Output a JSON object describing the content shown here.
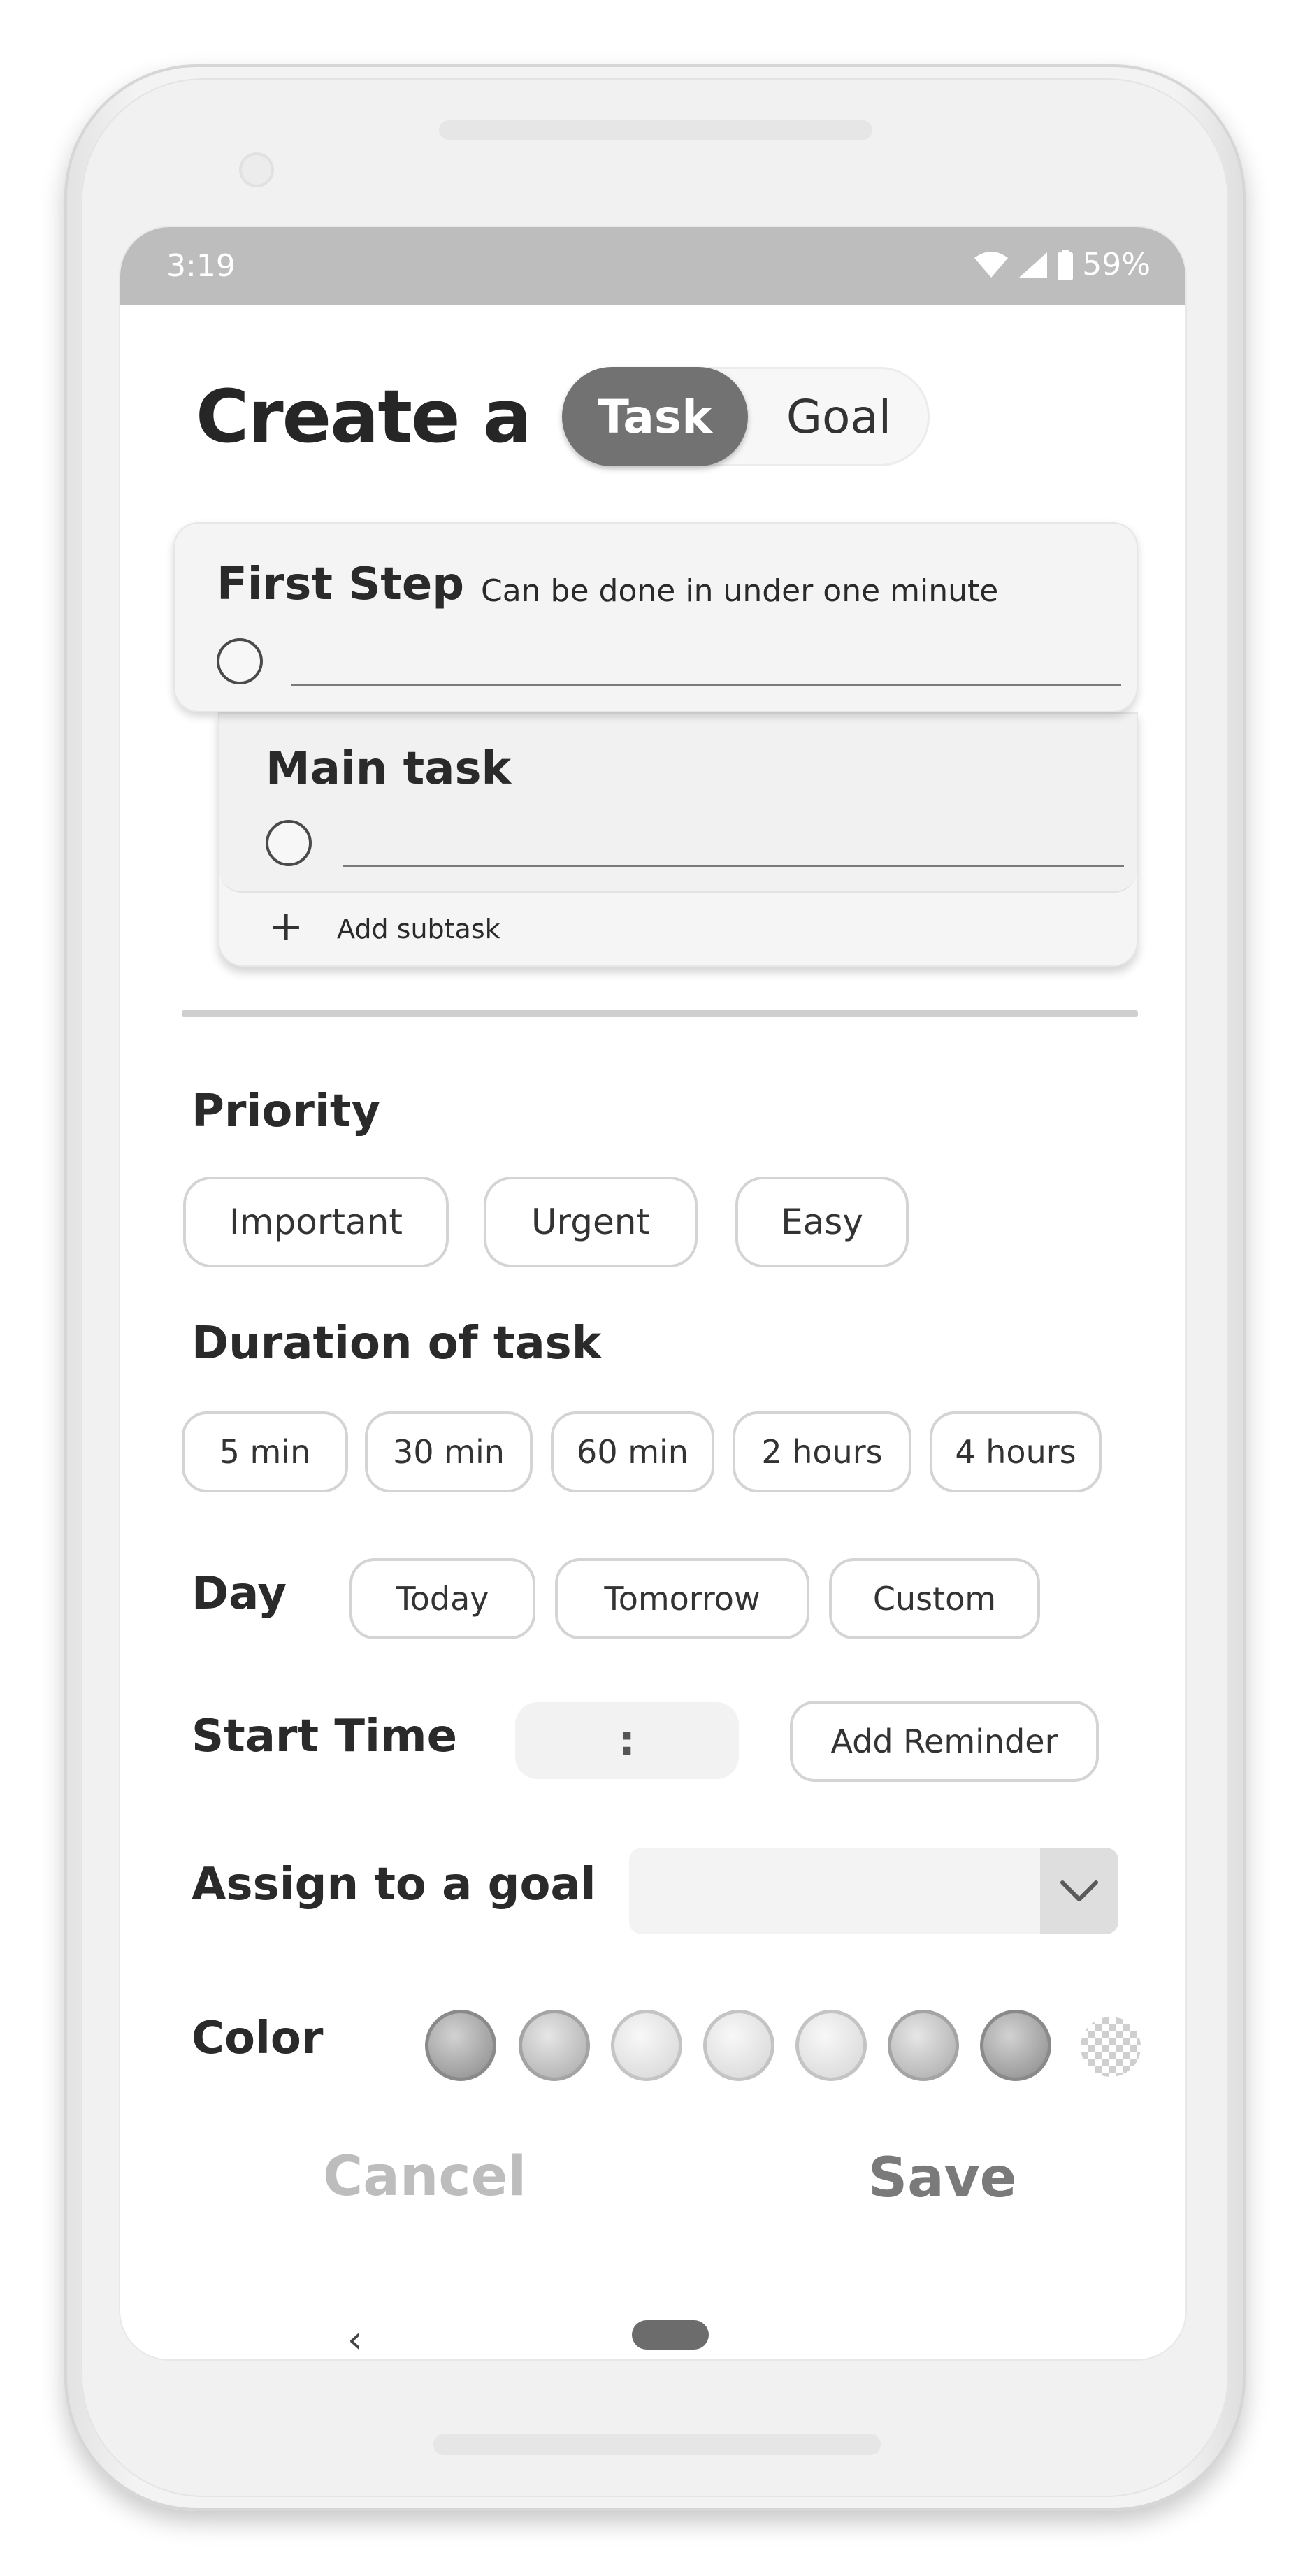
{
  "status_bar": {
    "time": "3:19",
    "battery": "59%",
    "icons": [
      "wifi-icon",
      "cell-signal-icon",
      "battery-icon"
    ]
  },
  "header": {
    "title": "Create a",
    "toggle": {
      "selected": "Task",
      "options": [
        "Task",
        "Goal"
      ]
    }
  },
  "first_step": {
    "heading": "First Step",
    "hint": "Can be done in under one minute",
    "value": ""
  },
  "main_task": {
    "heading": "Main task",
    "value": "",
    "add_subtask_label": "Add subtask",
    "add_icon": "plus-icon"
  },
  "priority": {
    "label": "Priority",
    "options": [
      "Important",
      "Urgent",
      "Easy"
    ]
  },
  "duration": {
    "label": "Duration of task",
    "options": [
      "5 min",
      "30 min",
      "60 min",
      "2 hours",
      "4 hours"
    ]
  },
  "day": {
    "label": "Day",
    "options": [
      "Today",
      "Tomorrow",
      "Custom"
    ]
  },
  "start_time": {
    "label": "Start Time",
    "value": ":",
    "reminder_button": "Add Reminder"
  },
  "assign_goal": {
    "label": "Assign to a goal",
    "selected": "",
    "dropdown_icon": "chevron-down-icon"
  },
  "color": {
    "label": "Color",
    "swatches": [
      "#9c9c9c",
      "#b8b8b8",
      "#dcdcdc",
      "#dcdcdc",
      "#dcdcdc",
      "#9c9c9c",
      "#9c9c9c",
      "none"
    ]
  },
  "actions": {
    "cancel": "Cancel",
    "save": "Save",
    "cancel_color": "#bdbdbd",
    "save_color": "#7a7a7a"
  },
  "nav": {
    "back_icon": "back-chevron-icon",
    "home_icon": "home-pill-icon"
  }
}
